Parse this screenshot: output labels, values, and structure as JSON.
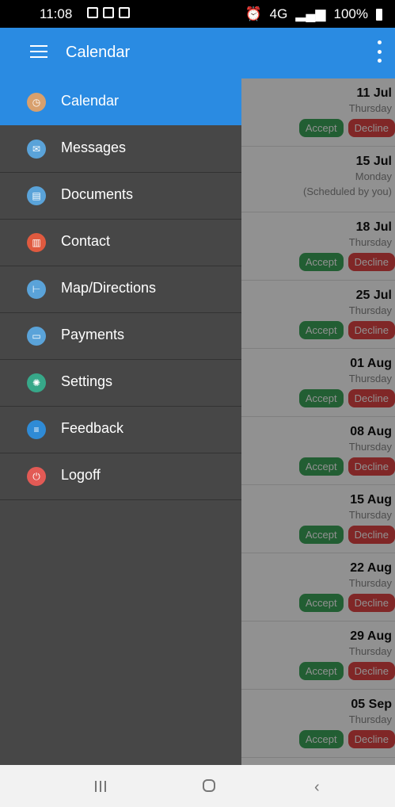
{
  "status": {
    "time": "11:08",
    "signal": "4G",
    "battery": "100%"
  },
  "appbar": {
    "title": "Calendar"
  },
  "drawer": {
    "items": [
      {
        "label": "Calendar",
        "icon": "clock-icon",
        "color": "#d8a06d",
        "active": true
      },
      {
        "label": "Messages",
        "icon": "mail-icon",
        "color": "#5aa3d9",
        "active": false
      },
      {
        "label": "Documents",
        "icon": "clipboard-icon",
        "color": "#5aa3d9",
        "active": false
      },
      {
        "label": "Contact",
        "icon": "addressbook-icon",
        "color": "#e05a3f",
        "active": false
      },
      {
        "label": "Map/Directions",
        "icon": "signpost-icon",
        "color": "#5aa3d9",
        "active": false
      },
      {
        "label": "Payments",
        "icon": "card-icon",
        "color": "#5aa3d9",
        "active": false
      },
      {
        "label": "Settings",
        "icon": "gear-icon",
        "color": "#37a889",
        "active": false
      },
      {
        "label": "Feedback",
        "icon": "chat-icon",
        "color": "#2f8bd6",
        "active": false
      },
      {
        "label": "Logoff",
        "icon": "power-icon",
        "color": "#e25a55",
        "active": false
      }
    ]
  },
  "calendar": {
    "accept_label": "Accept",
    "decline_label": "Decline",
    "entries": [
      {
        "date": "11 Jul",
        "day": "Thursday",
        "note": ""
      },
      {
        "date": "15 Jul",
        "day": "Monday",
        "note": "(Scheduled by you)"
      },
      {
        "date": "18 Jul",
        "day": "Thursday",
        "note": ""
      },
      {
        "date": "25 Jul",
        "day": "Thursday",
        "note": ""
      },
      {
        "date": "01 Aug",
        "day": "Thursday",
        "note": ""
      },
      {
        "date": "08 Aug",
        "day": "Thursday",
        "note": ""
      },
      {
        "date": "15 Aug",
        "day": "Thursday",
        "note": ""
      },
      {
        "date": "22 Aug",
        "day": "Thursday",
        "note": ""
      },
      {
        "date": "29 Aug",
        "day": "Thursday",
        "note": ""
      },
      {
        "date": "05 Sep",
        "day": "Thursday",
        "note": ""
      }
    ]
  }
}
